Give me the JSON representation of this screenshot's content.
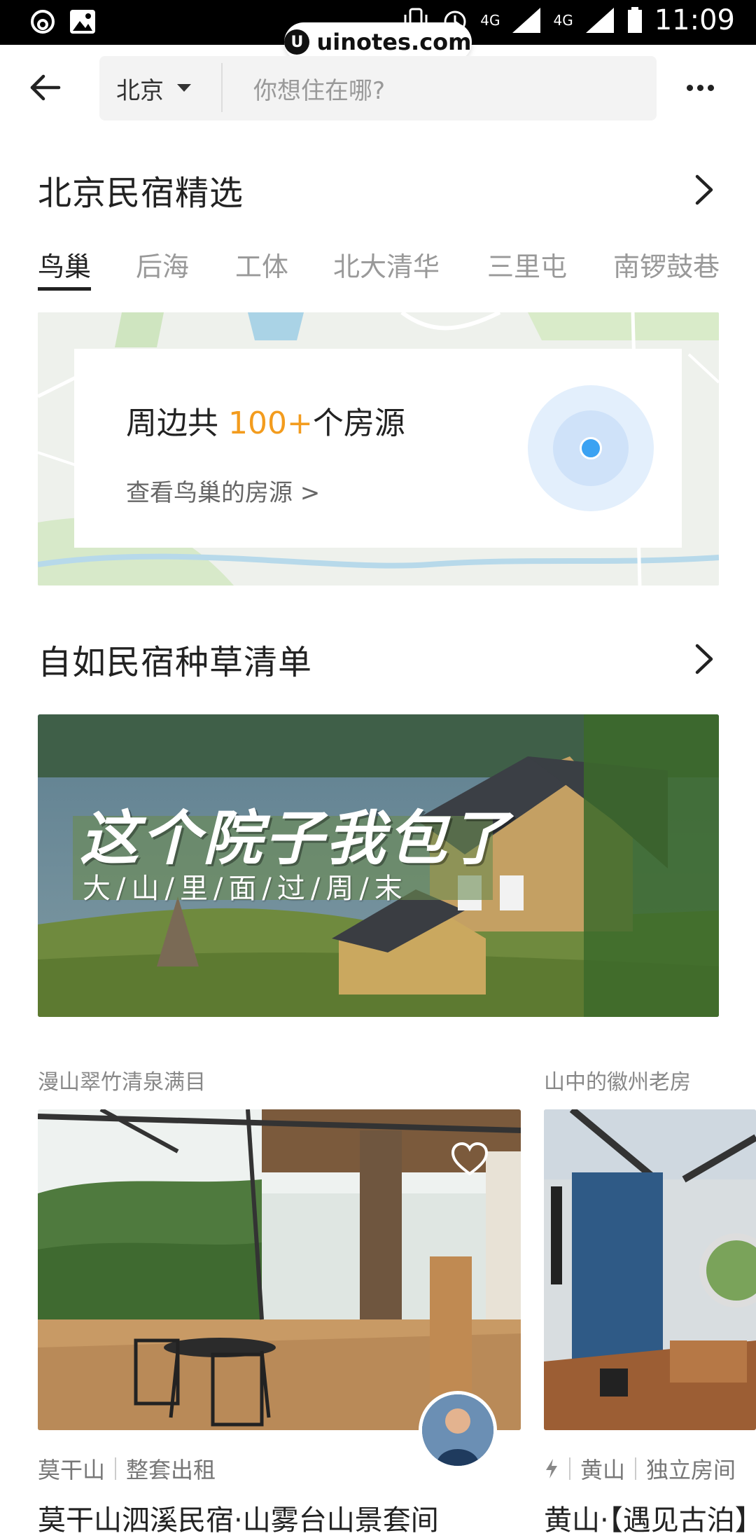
{
  "status_bar": {
    "time": "11:09",
    "network_1": "4G",
    "network_2": "4G"
  },
  "watermark": {
    "text": "uinotes.com"
  },
  "header": {
    "city": "北京",
    "search_placeholder": "你想住在哪?"
  },
  "section1": {
    "title": "北京民宿精选",
    "tabs": [
      {
        "label": "鸟巢",
        "active": true
      },
      {
        "label": "后海",
        "active": false
      },
      {
        "label": "工体",
        "active": false
      },
      {
        "label": "北大清华",
        "active": false
      },
      {
        "label": "三里屯",
        "active": false
      },
      {
        "label": "南锣鼓巷",
        "active": false
      }
    ],
    "map_card": {
      "count_prefix": "周边共 ",
      "count_value": "100+",
      "count_suffix": "个房源",
      "link": "查看鸟巢的房源 >"
    }
  },
  "section2": {
    "title": "自如民宿种草清单",
    "banner": {
      "title": "这个院子我包了",
      "subtitle": "大/山/里/面/过/周/末"
    }
  },
  "listings": [
    {
      "category": "漫山翠竹清泉满目",
      "location": "莫干山",
      "type": "整套出租",
      "name": "莫干山泗溪民宿·山雾台山景套间"
    },
    {
      "category": "山中的徽州老房",
      "location": "黄山",
      "type": "独立房间",
      "name": "黄山·【遇见古泊】"
    }
  ],
  "colors": {
    "accent": "#f39c1e",
    "location_dot": "#3ba2f2"
  }
}
